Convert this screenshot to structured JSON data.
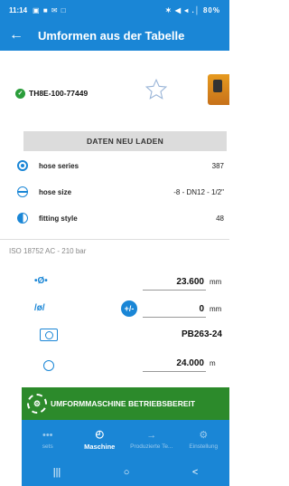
{
  "status": {
    "time": "11:14",
    "left_icons": "▣ ■ ✉ □",
    "right": "✶ ◀ ◂ .│ 80%"
  },
  "appbar": {
    "back_icon": "←",
    "title": "Umformen aus der Tabelle"
  },
  "product": {
    "code": "TH8E-100-77449"
  },
  "reload_label": "DATEN NEU LADEN",
  "params": [
    {
      "label": "hose series",
      "value": "387",
      "icon": "radio-filled-icon"
    },
    {
      "label": "hose size",
      "value": "-8 - DN12 - 1/2\"",
      "icon": "hose-size-icon"
    },
    {
      "label": "fitting style",
      "value": "48",
      "icon": "fitting-style-icon"
    }
  ],
  "spec": "ISO 18752 AC - 210 bar",
  "measurements": {
    "diameter": {
      "symbol": "•Ø•",
      "value": "23.600",
      "unit": "mm"
    },
    "tolerance": {
      "symbol": "/ø/",
      "value": "0",
      "unit": "mm",
      "toggle": "+/-"
    },
    "die": {
      "value": "PB263-24"
    },
    "fourth": {
      "value": "24.000",
      "unit": "m"
    }
  },
  "banner": {
    "icon": "⚙",
    "label": "UMFORMMASCHINE BETRIEBSBEREIT"
  },
  "nav": [
    {
      "label": "sets",
      "icon": "•••",
      "active": false
    },
    {
      "label": "Maschine",
      "icon": "◴",
      "active": true
    },
    {
      "label": "Produzierte Te...",
      "icon": "→",
      "active": false
    },
    {
      "label": "Einstellung",
      "icon": "⚙",
      "active": false
    }
  ],
  "sysnav": {
    "recent": "|||",
    "home": "○",
    "back": "<"
  }
}
